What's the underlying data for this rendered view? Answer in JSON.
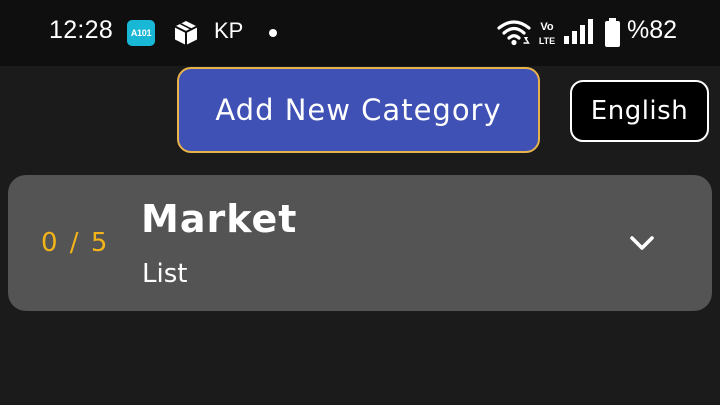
{
  "status_bar": {
    "time": "12:28",
    "app_badge": "A101",
    "carrier": "KP",
    "volte_top": "Vo",
    "volte_bottom": "LTE",
    "battery_percent": "%82",
    "battery_level": 0.82,
    "icons": [
      "a101-app-icon",
      "box-icon",
      "notification-dot-icon",
      "wifi-icon",
      "volte-icon",
      "signal-icon",
      "battery-icon"
    ]
  },
  "header": {
    "add_category_label": "Add New Category",
    "language_label": "English"
  },
  "categories": [
    {
      "progress": "0 / 5",
      "title": "Market",
      "subtitle": "List",
      "expand_icon": "chevron-down-icon"
    }
  ],
  "colors": {
    "background": "#1b1b1b",
    "status_bar": "#0f0f0f",
    "add_button_fill": "#3f51b5",
    "add_button_border": "#e7b24a",
    "card": "#545454",
    "progress_text": "#f2b418",
    "app_badge": "#19b7d6"
  }
}
